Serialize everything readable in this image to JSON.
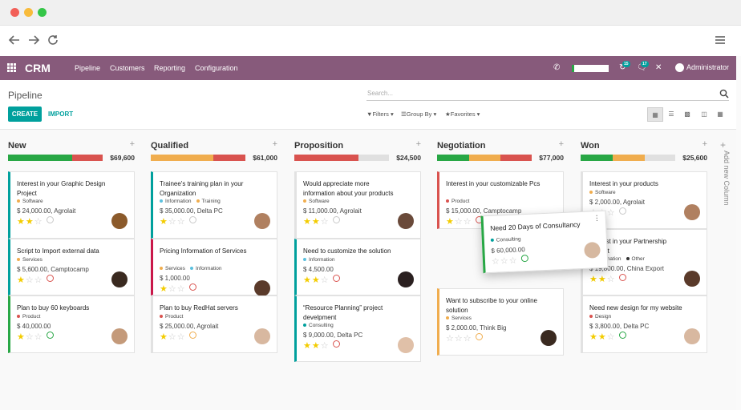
{
  "app": {
    "brand": "CRM",
    "menu": [
      "Pipeline",
      "Customers",
      "Reporting",
      "Configuration"
    ],
    "messages_count": "15",
    "chat_count": "17",
    "user": "Administrator"
  },
  "control": {
    "breadcrumb": "Pipeline",
    "search_placeholder": "Search...",
    "create_label": "CREATE",
    "import_label": "IMPORT",
    "filters_label": "Filters",
    "groupby_label": "Group By",
    "favorites_label": "Favorites"
  },
  "columns": [
    {
      "title": "New",
      "total": "$69,600",
      "cards": [
        {
          "title": "Interest in your Graphic Design Project",
          "tags": [
            {
              "label": "Software",
              "color": "#f0ad4e"
            }
          ],
          "amount": "$ 24,000.00, Agrolait",
          "stars": 2,
          "activity": "none",
          "border": "#00a09d"
        },
        {
          "title": "Script to Import external data",
          "tags": [
            {
              "label": "Services",
              "color": "#f0ad4e"
            }
          ],
          "amount": "$ 5,600.00, Camptocamp",
          "stars": 1,
          "activity": "overdue",
          "border": "#00a09d"
        },
        {
          "title": "Plan to buy 60 keyboards",
          "tags": [
            {
              "label": "Product",
              "color": "#d9534f"
            }
          ],
          "amount": "$ 40,000.00",
          "stars": 1,
          "activity": "planned",
          "border": "#28a745"
        }
      ]
    },
    {
      "title": "Qualified",
      "total": "$61,000",
      "cards": [
        {
          "title": "Trainee's training plan in your Organization",
          "tags": [
            {
              "label": "Information",
              "color": "#5bc0de"
            },
            {
              "label": "Training",
              "color": "#f0ad4e"
            }
          ],
          "amount": "$ 35,000.00, Delta PC",
          "stars": 1,
          "activity": "none",
          "border": "#00a09d"
        },
        {
          "title": "Pricing Information of Services",
          "tags": [
            {
              "label": "Services",
              "color": "#f0ad4e"
            },
            {
              "label": "Information",
              "color": "#5bc0de"
            }
          ],
          "amount": "$ 1,000.00",
          "stars": 1,
          "activity": "overdue",
          "border": "#c9184a"
        },
        {
          "title": "Plan to buy RedHat servers",
          "tags": [
            {
              "label": "Product",
              "color": "#d9534f"
            }
          ],
          "amount": "$ 25,000.00, Agrolait",
          "stars": 1,
          "activity": "today",
          "border": "#e2e2e2"
        }
      ]
    },
    {
      "title": "Proposition",
      "total": "$24,500",
      "cards": [
        {
          "title": "Would appreciate more information about your products",
          "tags": [
            {
              "label": "Software",
              "color": "#f0ad4e"
            }
          ],
          "amount": "$ 11,000.00, Agrolait",
          "stars": 2,
          "activity": "none",
          "border": "#e2e2e2"
        },
        {
          "title": "Need to customize the solution",
          "tags": [
            {
              "label": "Information",
              "color": "#5bc0de"
            }
          ],
          "amount": "$ 4,500.00",
          "stars": 2,
          "activity": "overdue",
          "border": "#00a09d"
        },
        {
          "title": "“Resource Planning” project develpment",
          "tags": [
            {
              "label": "Consulting",
              "color": "#00a09d"
            }
          ],
          "amount": "$ 9,000.00, Delta PC",
          "stars": 2,
          "activity": "overdue",
          "border": "#00a09d"
        }
      ]
    },
    {
      "title": "Negotiation",
      "total": "$77,000",
      "cards": [
        {
          "title": "Interest in your customizable Pcs",
          "tags": [
            {
              "label": "Product",
              "color": "#d9534f"
            }
          ],
          "amount": "$ 15,000.00, Camptocamp",
          "stars": 1,
          "activity": "overdue",
          "border": "#d9534f"
        },
        {
          "title": "Want to subscribe to your online solution",
          "tags": [
            {
              "label": "Services",
              "color": "#f0ad4e"
            }
          ],
          "amount": "$ 2,000.00, Think Big",
          "stars": 0,
          "activity": "today",
          "border": "#f0ad4e"
        }
      ]
    },
    {
      "title": "Won",
      "total": "$25,600",
      "cards": [
        {
          "title": "Interest in your products",
          "tags": [
            {
              "label": "Software",
              "color": "#f0ad4e"
            }
          ],
          "amount": "$ 2,000.00, Agrolait",
          "stars": 0,
          "activity": "none",
          "border": "#e2e2e2"
        },
        {
          "title": "Interest in your Partnership Project",
          "tags": [
            {
              "label": "Information",
              "color": "#5bc0de"
            },
            {
              "label": "Other",
              "color": "#333333"
            }
          ],
          "amount": "$ 19,800.00, China Export",
          "stars": 2,
          "activity": "overdue",
          "border": "#e2e2e2"
        },
        {
          "title": "Need new design for my website",
          "tags": [
            {
              "label": "Design",
              "color": "#d9534f"
            }
          ],
          "amount": "$ 3,800.00, Delta PC",
          "stars": 2,
          "activity": "planned",
          "border": "#e2e2e2"
        }
      ]
    }
  ],
  "dragged": {
    "title": "Need 20 Days of Consultancy",
    "tag": "Consulting",
    "amount": "$ 60,000.00",
    "stars": 0
  },
  "add_column_label": "Add new Column",
  "colors": {
    "brand": "#875a7b",
    "accent": "#00a09d",
    "won": "#28a745",
    "planned": "#f0ad4e",
    "overdue": "#d9534f"
  }
}
